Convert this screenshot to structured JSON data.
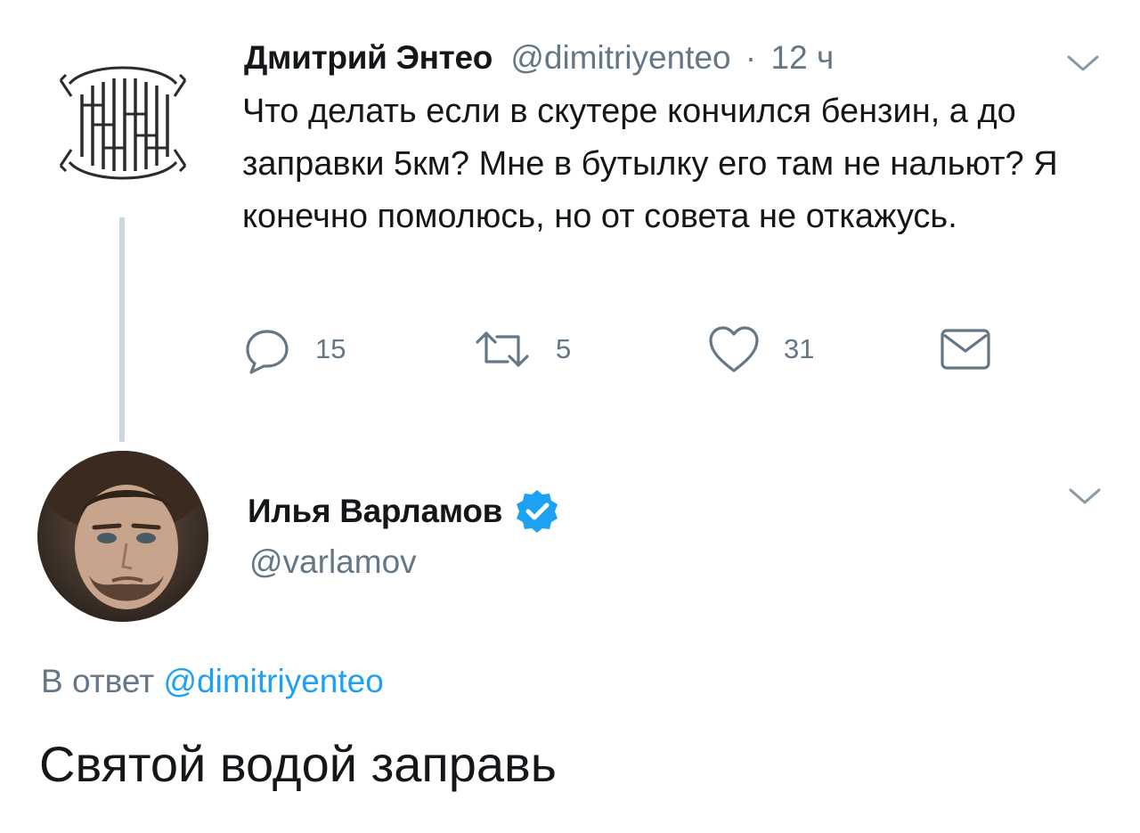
{
  "tweet1": {
    "author_name": "Дмитрий Энтео",
    "handle": "@dimitriyenteo",
    "separator": "·",
    "time": "12 ч",
    "text": "Что делать если в скутере кончился бензин, а до заправки 5км? Мне в бутылку его там не нальют? Я конечно помолюсь, но от совета не откажусь.",
    "avatar_icon": "slavic-monogram-emblem-icon",
    "actions": {
      "reply_count": "15",
      "retweet_count": "5",
      "like_count": "31"
    }
  },
  "tweet2": {
    "author_name": "Илья Варламов",
    "verified": true,
    "handle": "@varlamov",
    "reply_prefix": "В ответ",
    "reply_to": "@dimitriyenteo",
    "text": "Святой водой заправь"
  },
  "colors": {
    "text_primary": "#14171a",
    "text_secondary": "#657786",
    "link_blue": "#1da1f2",
    "thread_line": "#ccd6dd"
  }
}
